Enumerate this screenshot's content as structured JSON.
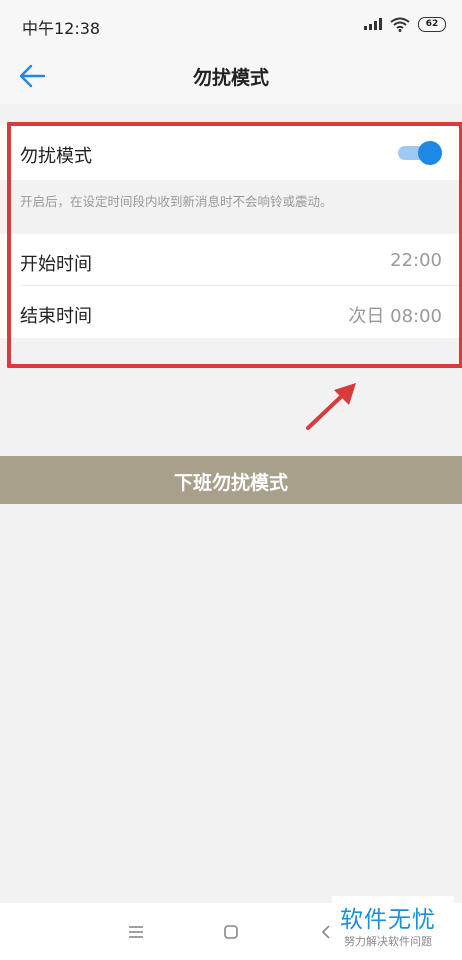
{
  "status_bar": {
    "time": "中午12:38",
    "battery": "62"
  },
  "app_bar": {
    "title": "勿扰模式"
  },
  "dnd": {
    "label": "勿扰模式",
    "enabled": true,
    "hint": "开启后，在设定时间段内收到新消息时不会响铃或震动。"
  },
  "schedule": {
    "start_label": "开始时间",
    "start_value": "22:00",
    "end_label": "结束时间",
    "end_value": "次日 08:00"
  },
  "caption": "下班勿扰模式",
  "watermark": {
    "title": "软件无忧",
    "subtitle": "努力解决软件问题"
  },
  "colors": {
    "accent": "#1e88e5",
    "highlight": "#d93a3a",
    "banner": "#a8a08a",
    "watermark": "#1a8fd6"
  },
  "icons": [
    "signal-icon",
    "wifi-icon",
    "battery-icon",
    "back-arrow-icon",
    "menu-icon",
    "home-icon",
    "back-icon"
  ]
}
